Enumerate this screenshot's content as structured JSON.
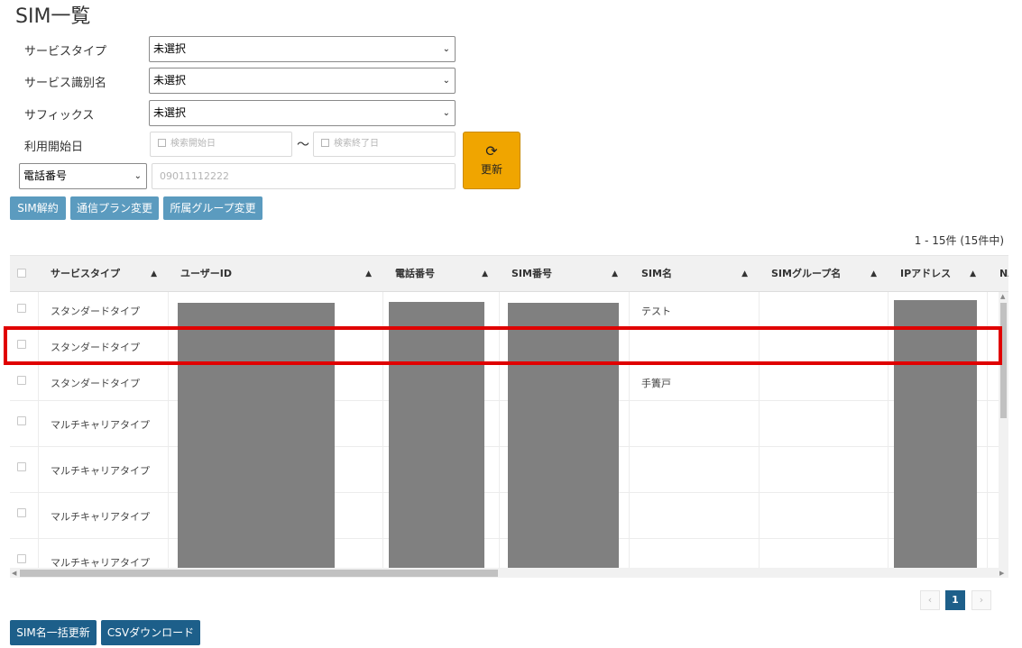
{
  "page": {
    "title": "SIM一覧"
  },
  "filters": {
    "service_type": {
      "label": "サービスタイプ",
      "value": "未選択"
    },
    "service_id_name": {
      "label": "サービス識別名",
      "value": "未選択"
    },
    "suffix": {
      "label": "サフィックス",
      "value": "未選択"
    },
    "start_date": {
      "label": "利用開始日",
      "from_placeholder": "検索開始日",
      "to_placeholder": "検索終了日",
      "separator": "～"
    },
    "search_field": {
      "value": "電話番号",
      "placeholder": "09011112222"
    },
    "refresh_label": "更新",
    "refresh_icon": "refresh-icon"
  },
  "actions": {
    "cancel": "SIM解約",
    "plan_change": "通信プラン変更",
    "group_change": "所属グループ変更"
  },
  "table": {
    "count_text": "1 - 15件 (15件中)",
    "columns": [
      "サービスタイプ",
      "ユーザーID",
      "電話番号",
      "SIM番号",
      "SIM名",
      "SIMグループ名",
      "IPアドレス",
      "NA"
    ],
    "sort_icon": "▲",
    "rows": [
      {
        "service_type": "スタンダードタイプ",
        "sim_name": "テスト"
      },
      {
        "service_type": "スタンダードタイプ",
        "sim_name": ""
      },
      {
        "service_type": "スタンダードタイプ",
        "sim_name": "手簀戸"
      },
      {
        "service_type": "マルチキャリアタイプ",
        "sim_name": ""
      },
      {
        "service_type": "マルチキャリアタイプ",
        "sim_name": ""
      },
      {
        "service_type": "マルチキャリアタイプ",
        "sim_name": ""
      },
      {
        "service_type": "マルチキャリアタイプ",
        "sim_name": ""
      }
    ]
  },
  "pagination": {
    "prev": "‹",
    "current": "1",
    "next": "›"
  },
  "bottom_actions": {
    "bulk_rename": "SIM名一括更新",
    "csv_download": "CSVダウンロード"
  },
  "colors": {
    "primary": "#1d5f8a",
    "secondary_button": "#5b9bbf",
    "refresh_button": "#f0a500",
    "highlight": "#e00000",
    "redaction": "#808080"
  }
}
